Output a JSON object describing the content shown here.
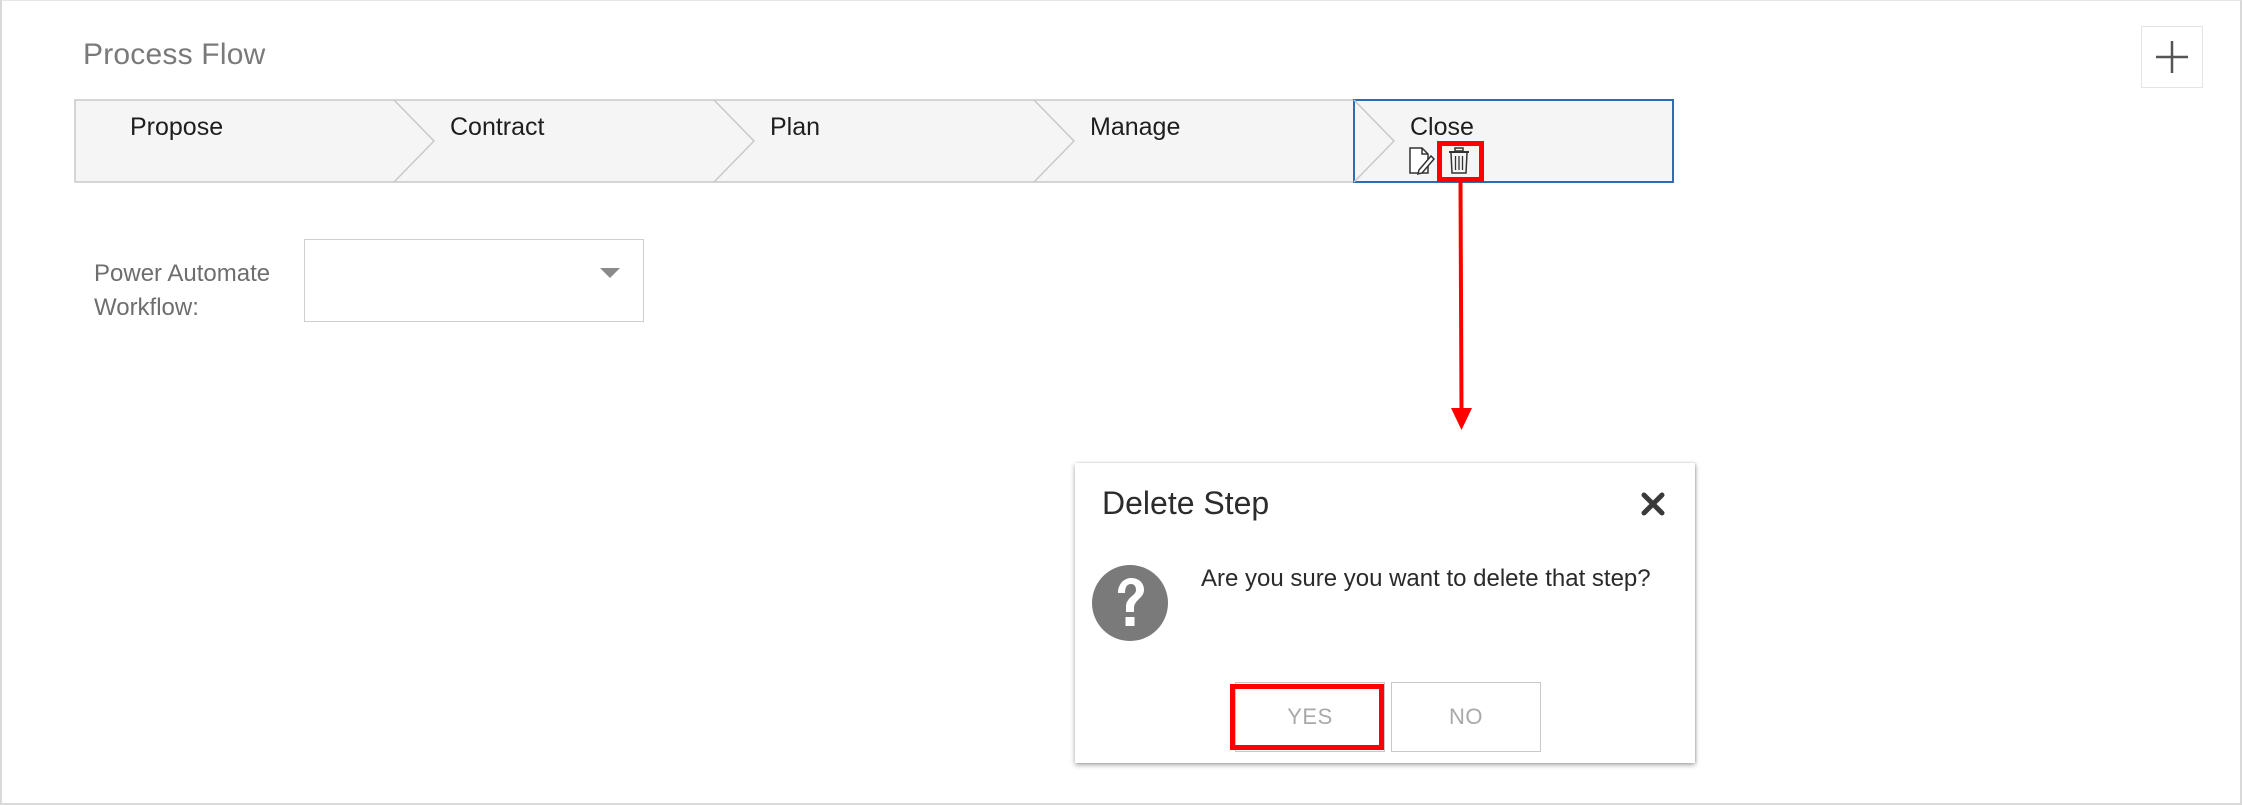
{
  "page": {
    "title": "Process Flow"
  },
  "toolbar": {
    "add_icon": "plus-icon"
  },
  "stages": [
    {
      "label": "Propose"
    },
    {
      "label": "Contract"
    },
    {
      "label": "Plan"
    },
    {
      "label": "Manage"
    },
    {
      "label": "Close",
      "selected": true
    }
  ],
  "stage_tools": {
    "edit_icon": "edit-document-icon",
    "delete_icon": "trash-icon"
  },
  "workflow_field": {
    "label": "Power Automate Workflow:",
    "value": ""
  },
  "dialog": {
    "title": "Delete Step",
    "message": "Are you sure you want to delete that step?",
    "yes_label": "YES",
    "no_label": "NO",
    "icon": "question-icon"
  },
  "colors": {
    "selected_stage_border": "#2e6db3",
    "annotation": "#ff0000",
    "stage_fill": "#f5f5f5"
  }
}
